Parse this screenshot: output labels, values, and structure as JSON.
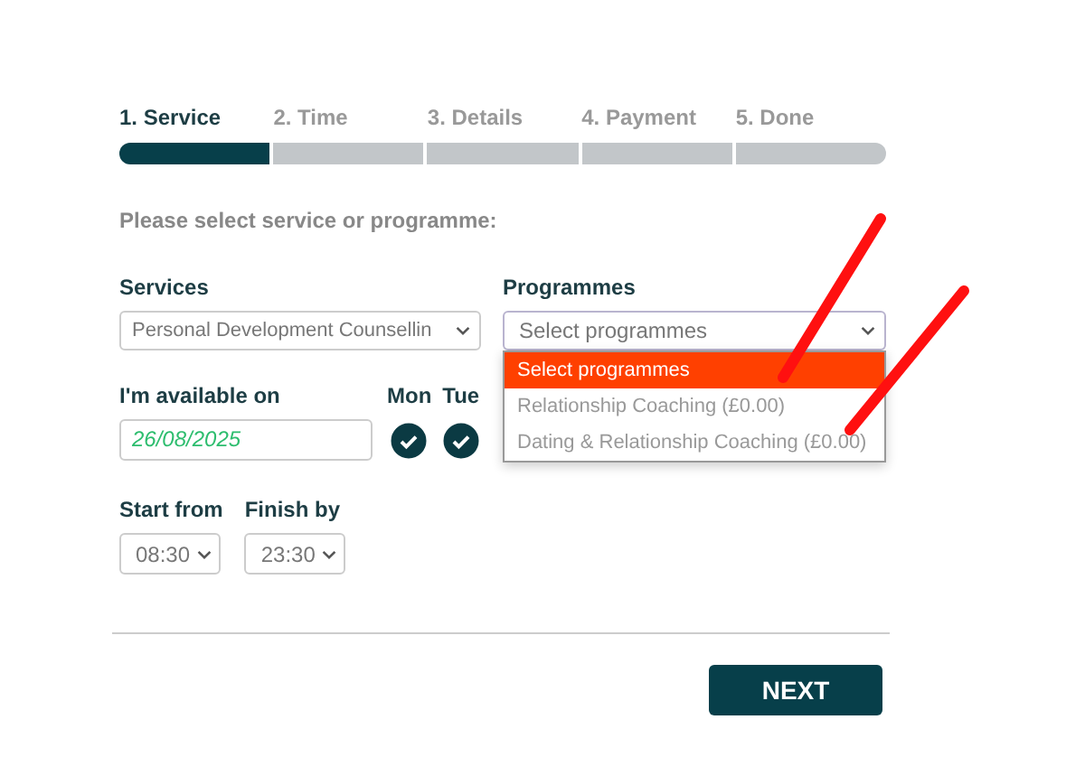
{
  "steps": [
    {
      "label": "1. Service",
      "selected": true
    },
    {
      "label": "2. Time",
      "selected": false
    },
    {
      "label": "3. Details",
      "selected": false
    },
    {
      "label": "4. Payment",
      "selected": false
    },
    {
      "label": "5. Done",
      "selected": false
    }
  ],
  "prompt": "Please select service or programme:",
  "services": {
    "label": "Services",
    "value": "Personal Development Counsellin"
  },
  "programmes": {
    "label": "Programmes",
    "value": "Select programmes",
    "options": [
      {
        "label": "Select programmes",
        "selected": true
      },
      {
        "label": "Relationship Coaching (£0.00)",
        "selected": false
      },
      {
        "label": "Dating & Relationship Coaching (£0.00)",
        "selected": false
      }
    ]
  },
  "availability": {
    "label": "I'm available on",
    "date": "26/08/2025",
    "days": [
      {
        "label": "Mon",
        "checked": true
      },
      {
        "label": "Tue",
        "checked": true
      }
    ]
  },
  "start": {
    "label": "Start from",
    "value": "08:30"
  },
  "finish": {
    "label": "Finish by",
    "value": "23:30"
  },
  "next_button": "NEXT"
}
